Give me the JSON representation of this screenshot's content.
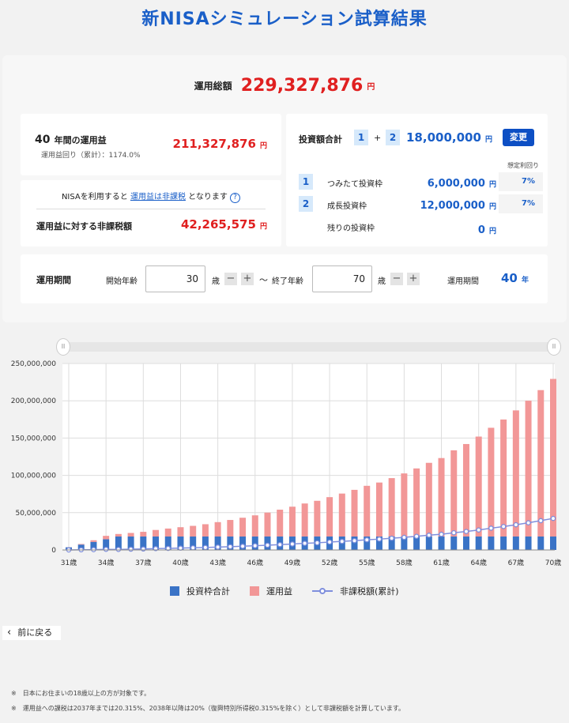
{
  "page_title": "新NISAシミュレーション試算結果",
  "total": {
    "label": "運用総額",
    "value": "229,327,876",
    "unit": "円"
  },
  "profit": {
    "years_num": "40",
    "years_label": "年間の運用益",
    "rate_label": "運用益回り（累計）：1174.0%",
    "value": "211,327,876",
    "unit": "円"
  },
  "taxfree": {
    "note_prefix": "NISAを利用すると",
    "note_link": "運用益は非課税",
    "note_suffix": "となります",
    "help_icon": "?",
    "label": "運用益に対する非課税額",
    "value": "42,265,575",
    "unit": "円"
  },
  "invest": {
    "label": "投資額合計",
    "box1": "1",
    "plus": "+",
    "box2": "2",
    "value": "18,000,000",
    "unit": "円",
    "change_button": "変更",
    "rate_header": "想定利回り",
    "rows": [
      {
        "num": "1",
        "label": "つみたて投資枠",
        "value": "6,000,000",
        "unit": "円",
        "rate": "7%"
      },
      {
        "num": "2",
        "label": "成長投資枠",
        "value": "12,000,000",
        "unit": "円",
        "rate": "7%"
      },
      {
        "num": "",
        "label": "残りの投資枠",
        "value": "0",
        "unit": "円",
        "rate": ""
      }
    ]
  },
  "period": {
    "label": "運用期間",
    "start_label": "開始年齢",
    "start_value": "30",
    "start_unit": "歳",
    "tilde": "～",
    "end_label": "終了年齢",
    "end_value": "70",
    "end_unit": "歳",
    "result_label": "運用期間",
    "result_value": "40",
    "result_unit": "年",
    "minus": "−",
    "plusgl": "+"
  },
  "chart_data": {
    "type": "bar",
    "categories": [
      "31歳",
      "32歳",
      "33歳",
      "34歳",
      "35歳",
      "36歳",
      "37歳",
      "38歳",
      "39歳",
      "40歳",
      "41歳",
      "42歳",
      "43歳",
      "44歳",
      "45歳",
      "46歳",
      "47歳",
      "48歳",
      "49歳",
      "50歳",
      "51歳",
      "52歳",
      "53歳",
      "54歳",
      "55歳",
      "56歳",
      "57歳",
      "58歳",
      "59歳",
      "60歳",
      "61歳",
      "62歳",
      "63歳",
      "64歳",
      "65歳",
      "66歳",
      "67歳",
      "68歳",
      "69歳",
      "70歳"
    ],
    "xtick_labels": [
      "31歳",
      "34歳",
      "37歳",
      "40歳",
      "43歳",
      "46歳",
      "49歳",
      "52歳",
      "55歳",
      "58歳",
      "61歳",
      "64歳",
      "67歳",
      "70歳"
    ],
    "ylim": [
      0,
      250000000
    ],
    "ytick_labels": [
      "0",
      "50,000,000",
      "100,000,000",
      "150,000,000",
      "200,000,000",
      "250,000,000"
    ],
    "series": [
      {
        "name": "投資枠合計",
        "type": "bar",
        "color": "#3a73c6",
        "values": [
          3600000,
          7200000,
          10800000,
          14400000,
          18000000,
          18000000,
          18000000,
          18000000,
          18000000,
          18000000,
          18000000,
          18000000,
          18000000,
          18000000,
          18000000,
          18000000,
          18000000,
          18000000,
          18000000,
          18000000,
          18000000,
          18000000,
          18000000,
          18000000,
          18000000,
          18000000,
          18000000,
          18000000,
          18000000,
          18000000,
          18000000,
          18000000,
          18000000,
          18000000,
          18000000,
          18000000,
          18000000,
          18000000,
          18000000,
          18000000
        ]
      },
      {
        "name": "運用益",
        "type": "bar",
        "color": "#f29797",
        "values": [
          100000,
          800000,
          2200000,
          4500000,
          3400000,
          4800000,
          6300000,
          8800000,
          10700000,
          12500000,
          14300000,
          16500000,
          19300000,
          22200000,
          25200000,
          28400000,
          32100000,
          36000000,
          40000000,
          44300000,
          47900000,
          52800000,
          57600000,
          62600000,
          68000000,
          72400000,
          78300000,
          84600000,
          91300000,
          98800000,
          105200000,
          115600000,
          124000000,
          134000000,
          145800000,
          156900000,
          169100000,
          182100000,
          196300000,
          211300000
        ]
      },
      {
        "name": "非課税額(累計)",
        "type": "line",
        "color": "#7f8fdd",
        "values": [
          0,
          200000,
          400000,
          800000,
          700000,
          1000000,
          1300000,
          1800000,
          2100000,
          2500000,
          2900000,
          3300000,
          3900000,
          4400000,
          5000000,
          5700000,
          6400000,
          7200000,
          8000000,
          8900000,
          9600000,
          10600000,
          11500000,
          12500000,
          13600000,
          14500000,
          15700000,
          16900000,
          18300000,
          19800000,
          21000000,
          23100000,
          24800000,
          26800000,
          29200000,
          31400000,
          33800000,
          36400000,
          39300000,
          42300000
        ]
      }
    ]
  },
  "legend": {
    "items": [
      "投資枠合計",
      "運用益",
      "非課税額(累計)"
    ]
  },
  "slider": {
    "handle_glyph": "ll"
  },
  "back_button": {
    "icon": "‹",
    "label": "前に戻る"
  },
  "notes": [
    "※　日本にお住まいの18歳以上の方が対象です。",
    "※　運用益への課税は2037年までは20.315%、2038年以降は20%（復興特別所得税0.315%を除く）として非課税額を計算しています。"
  ],
  "colors": {
    "accent": "#1a5fc8",
    "red": "#e02020",
    "bar_invest": "#3a73c6",
    "bar_profit": "#f29797",
    "line": "#7f8fdd"
  }
}
